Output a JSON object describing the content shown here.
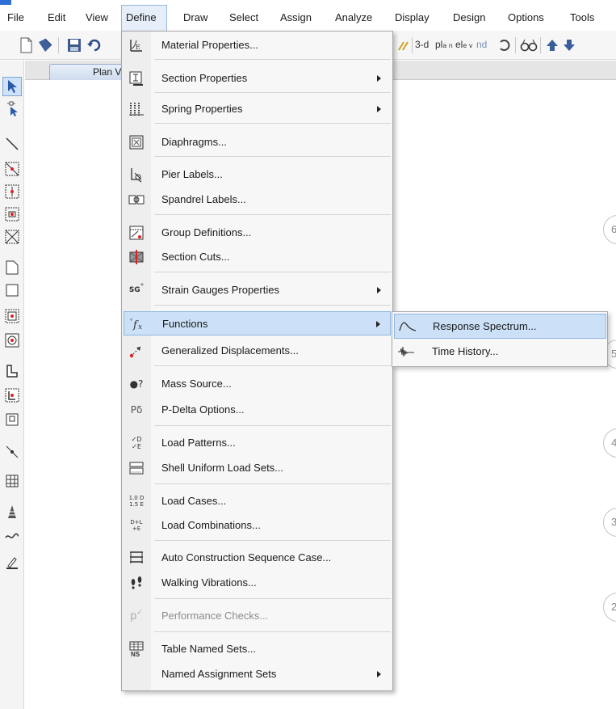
{
  "menubar": {
    "items": [
      {
        "label": "File"
      },
      {
        "label": "Edit"
      },
      {
        "label": "View"
      },
      {
        "label": "Define"
      },
      {
        "label": "Draw"
      },
      {
        "label": "Select"
      },
      {
        "label": "Assign"
      },
      {
        "label": "Analyze"
      },
      {
        "label": "Display"
      },
      {
        "label": "Design"
      },
      {
        "label": "Options"
      },
      {
        "label": "Tools"
      }
    ],
    "active": "Define"
  },
  "toolbar": {
    "view_3d": "3-d",
    "plan": "pl",
    "plan_sub": "a n",
    "elev": "el",
    "elev_sub": "e v",
    "nd": "nd"
  },
  "tab": {
    "label": "Plan View"
  },
  "bubbles": [
    "6",
    "5",
    "4",
    "3",
    "2"
  ],
  "define_menu": {
    "items": [
      {
        "label": "Material Properties...",
        "icon": "material-icon",
        "submenu": false
      },
      {
        "label": "Section Properties",
        "icon": "section-icon",
        "submenu": true
      },
      {
        "label": "Spring Properties",
        "icon": "spring-icon",
        "submenu": true
      },
      {
        "label": "Diaphragms...",
        "icon": "diaphragm-icon",
        "submenu": false
      },
      {
        "label": "Pier Labels...",
        "icon": "pier-icon",
        "submenu": false
      },
      {
        "label": "Spandrel Labels...",
        "icon": "spandrel-icon",
        "submenu": false
      },
      {
        "label": "Group Definitions...",
        "icon": "group-icon",
        "submenu": false
      },
      {
        "label": "Section Cuts...",
        "icon": "section-cut-icon",
        "submenu": false
      },
      {
        "label": "Strain Gauges Properties",
        "icon": "strain-gauge-icon",
        "submenu": true
      },
      {
        "label": "Functions",
        "icon": "function-icon",
        "submenu": true
      },
      {
        "label": "Generalized Displacements...",
        "icon": "displacement-icon",
        "submenu": false
      },
      {
        "label": "Mass Source...",
        "icon": "mass-icon",
        "submenu": false
      },
      {
        "label": "P-Delta Options...",
        "icon": "pdelta-icon",
        "submenu": false
      },
      {
        "label": "Load Patterns...",
        "icon": "load-pattern-icon",
        "submenu": false
      },
      {
        "label": "Shell Uniform Load Sets...",
        "icon": "shell-load-icon",
        "submenu": false
      },
      {
        "label": "Load Cases...",
        "icon": "load-case-icon",
        "submenu": false
      },
      {
        "label": "Load Combinations...",
        "icon": "load-combo-icon",
        "submenu": false
      },
      {
        "label": "Auto Construction Sequence Case...",
        "icon": "construction-icon",
        "submenu": false
      },
      {
        "label": "Walking Vibrations...",
        "icon": "footsteps-icon",
        "submenu": false
      },
      {
        "label": "Performance Checks...",
        "icon": "performance-icon",
        "submenu": false,
        "disabled": true
      },
      {
        "label": "Table Named Sets...",
        "icon": "table-icon",
        "submenu": false
      },
      {
        "label": "Named Assignment Sets",
        "icon": "",
        "submenu": true
      }
    ],
    "hovered": "Functions"
  },
  "functions_submenu": {
    "items": [
      {
        "label": "Response Spectrum...",
        "icon": "spectrum-curve-icon"
      },
      {
        "label": "Time History...",
        "icon": "time-history-icon"
      }
    ],
    "hovered": "Response Spectrum..."
  },
  "icon_glyphs": {
    "sg": "SG",
    "pdelta": "Pδ",
    "loadcase_a": "1.0 D",
    "loadcase_b": "1.5 E",
    "combo_a": "D+L",
    "combo_b": "+E",
    "ns": "NS",
    "pv": "p",
    "mass": "●?",
    "lp_a": "✓D",
    "lp_b": "✓E"
  },
  "colors": {
    "accent": "#2f6fd6",
    "highlight": "#cce1f7",
    "highlight_border": "#8fb6e2"
  }
}
